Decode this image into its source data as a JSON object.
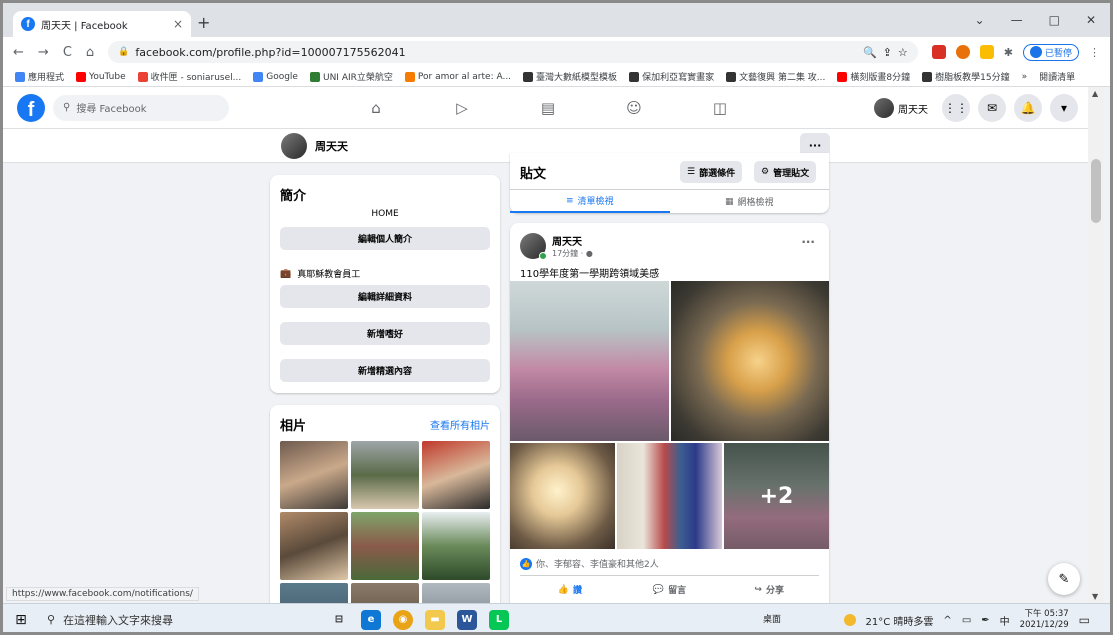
{
  "browser": {
    "tab_title": "周天天 | Facebook",
    "tab_close": "×",
    "new_tab": "+",
    "win_min": "—",
    "win_max": "□",
    "win_close": "✕",
    "back": "←",
    "forward": "→",
    "reload": "C",
    "home": "⌂",
    "url": "facebook.com/profile.php?id=100007175562041",
    "ext_pause_label": "已暫停",
    "bookmarks": [
      {
        "label": "應用程式",
        "color": "#4285f4"
      },
      {
        "label": "YouTube",
        "color": "#ff0000"
      },
      {
        "label": "收件匣 - soniarusel...",
        "color": "#ea4335"
      },
      {
        "label": "Google",
        "color": "#4285f4"
      },
      {
        "label": "UNI AIR立榮航空",
        "color": "#2e7d32"
      },
      {
        "label": "Por amor al arte: A...",
        "color": "#f57c00"
      },
      {
        "label": "臺灣大數紙模型模板",
        "color": "#333333"
      },
      {
        "label": "保加利亞寫實畫家",
        "color": "#333333"
      },
      {
        "label": "文藝復興 第二集 攻...",
        "color": "#333333"
      },
      {
        "label": "橫刻版畫8分鐘",
        "color": "#ff0000"
      },
      {
        "label": "樹脂板教學15分鐘",
        "color": "#333333"
      }
    ],
    "bookmarks_more": "»",
    "reading_list": "閱讀清單"
  },
  "facebook": {
    "logo": "f",
    "search_placeholder": "搜尋 Facebook",
    "user_short": "周天天",
    "profile_name": "周天天",
    "more": "···"
  },
  "intro": {
    "title": "簡介",
    "home_text": "HOME",
    "edit_bio": "編輯個人簡介",
    "job": "真耶穌教會員工",
    "edit_details": "編輯詳細資料",
    "add_hobbies": "新增嗜好",
    "add_featured": "新增精選內容"
  },
  "photos": {
    "title": "相片",
    "see_all": "查看所有相片"
  },
  "posts": {
    "title": "貼文",
    "filter": "篩選條件",
    "manage": "管理貼文",
    "list_view": "清單檢視",
    "grid_view": "網格檢視"
  },
  "post": {
    "author": "周天天",
    "time": "17分鐘 · ",
    "text": "110學年度第一學期跨領域美感",
    "more_photos": "+2",
    "reactions": "你、李郁容、李值豪和其他2人",
    "like": "讚",
    "comment": "留言",
    "share": "分享"
  },
  "status_url": "https://www.facebook.com/notifications/",
  "taskbar": {
    "search_placeholder": "在這裡輸入文字來搜尋",
    "desktop": "桌面",
    "weather": "21°C 晴時多雲",
    "ime": "中",
    "time": "下午 05:37",
    "date": "2021/12/29"
  },
  "colors": {
    "facebook_blue": "#1877f2",
    "bg": "#f0f2f5"
  }
}
